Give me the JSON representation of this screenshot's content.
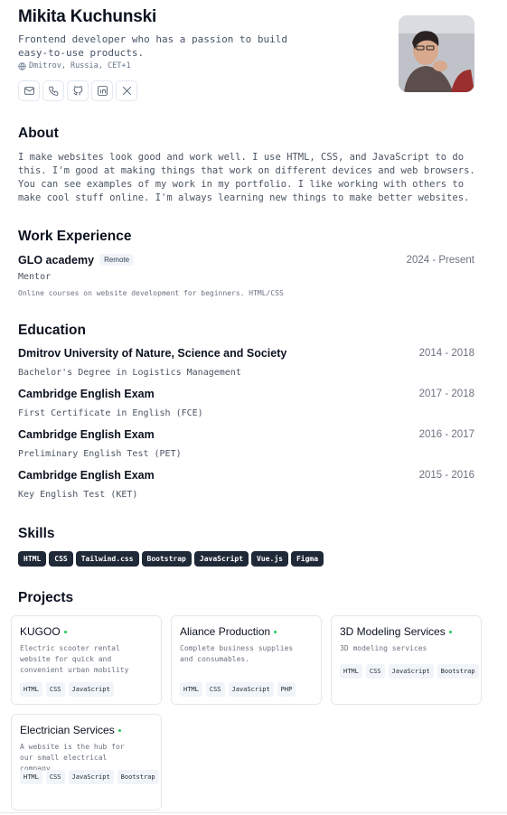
{
  "header": {
    "name": "Mikita Kuchunski",
    "tagline": "Frontend developer who has a passion to build easy-to-use products.",
    "location": "Dmitrov, Russia, CET+1",
    "contacts": [
      {
        "icon": "mail-icon"
      },
      {
        "icon": "phone-icon"
      },
      {
        "icon": "github-icon"
      },
      {
        "icon": "linkedin-icon"
      },
      {
        "icon": "x-icon"
      }
    ]
  },
  "about": {
    "title": "About",
    "text": "I make websites look good and work well. I use HTML, CSS, and JavaScript to do this. I'm good at making things that work on different devices and web browsers. You can see examples of my work in my portfolio. I like working with others to make cool stuff online. I'm always learning new things to make better websites."
  },
  "work": {
    "title": "Work Experience",
    "items": [
      {
        "company": "GLO academy",
        "badge": "Remote",
        "dates": "2024 - Present",
        "role": "Mentor",
        "description": "Online courses on website development for beginners. HTML/CSS"
      }
    ]
  },
  "education": {
    "title": "Education",
    "items": [
      {
        "school": "Dmitrov University of Nature, Science and Society",
        "dates": "2014 - 2018",
        "degree": "Bachelor's Degree in Logistics Management"
      },
      {
        "school": "Cambridge English Exam",
        "dates": "2017 - 2018",
        "degree": "First Certificate in English (FCE)"
      },
      {
        "school": "Cambridge English Exam",
        "dates": "2016 - 2017",
        "degree": "Preliminary English Test (PET)"
      },
      {
        "school": "Cambridge English Exam",
        "dates": "2015 - 2016",
        "degree": "Key English Test (KET)"
      }
    ]
  },
  "skills": {
    "title": "Skills",
    "items": [
      "HTML",
      "CSS",
      "Tailwind.css",
      "Bootstrap",
      "JavaScript",
      "Vue.js",
      "Figma"
    ]
  },
  "projects": {
    "title": "Projects",
    "items": [
      {
        "title": "KUGOO",
        "description": "Electric scooter rental website for quick and convenient urban mobility",
        "tags": [
          "HTML",
          "CSS",
          "JavaScript"
        ]
      },
      {
        "title": "Aliance Production",
        "description": "Complete business supplies and consumables.",
        "tags": [
          "HTML",
          "CSS",
          "JavaScript",
          "PHP"
        ]
      },
      {
        "title": "3D Modeling Services",
        "description": "3D modeling services",
        "tags": [
          "HTML",
          "CSS",
          "JavaScript",
          "Bootstrap"
        ]
      },
      {
        "title": "Electrician Services",
        "description": "A website is the hub for our small electrical company",
        "tags": [
          "HTML",
          "CSS",
          "JavaScript",
          "Bootstrap"
        ]
      }
    ]
  },
  "colors": {
    "skill_bg": "#1f2937",
    "status_dot": "#22c55e"
  }
}
